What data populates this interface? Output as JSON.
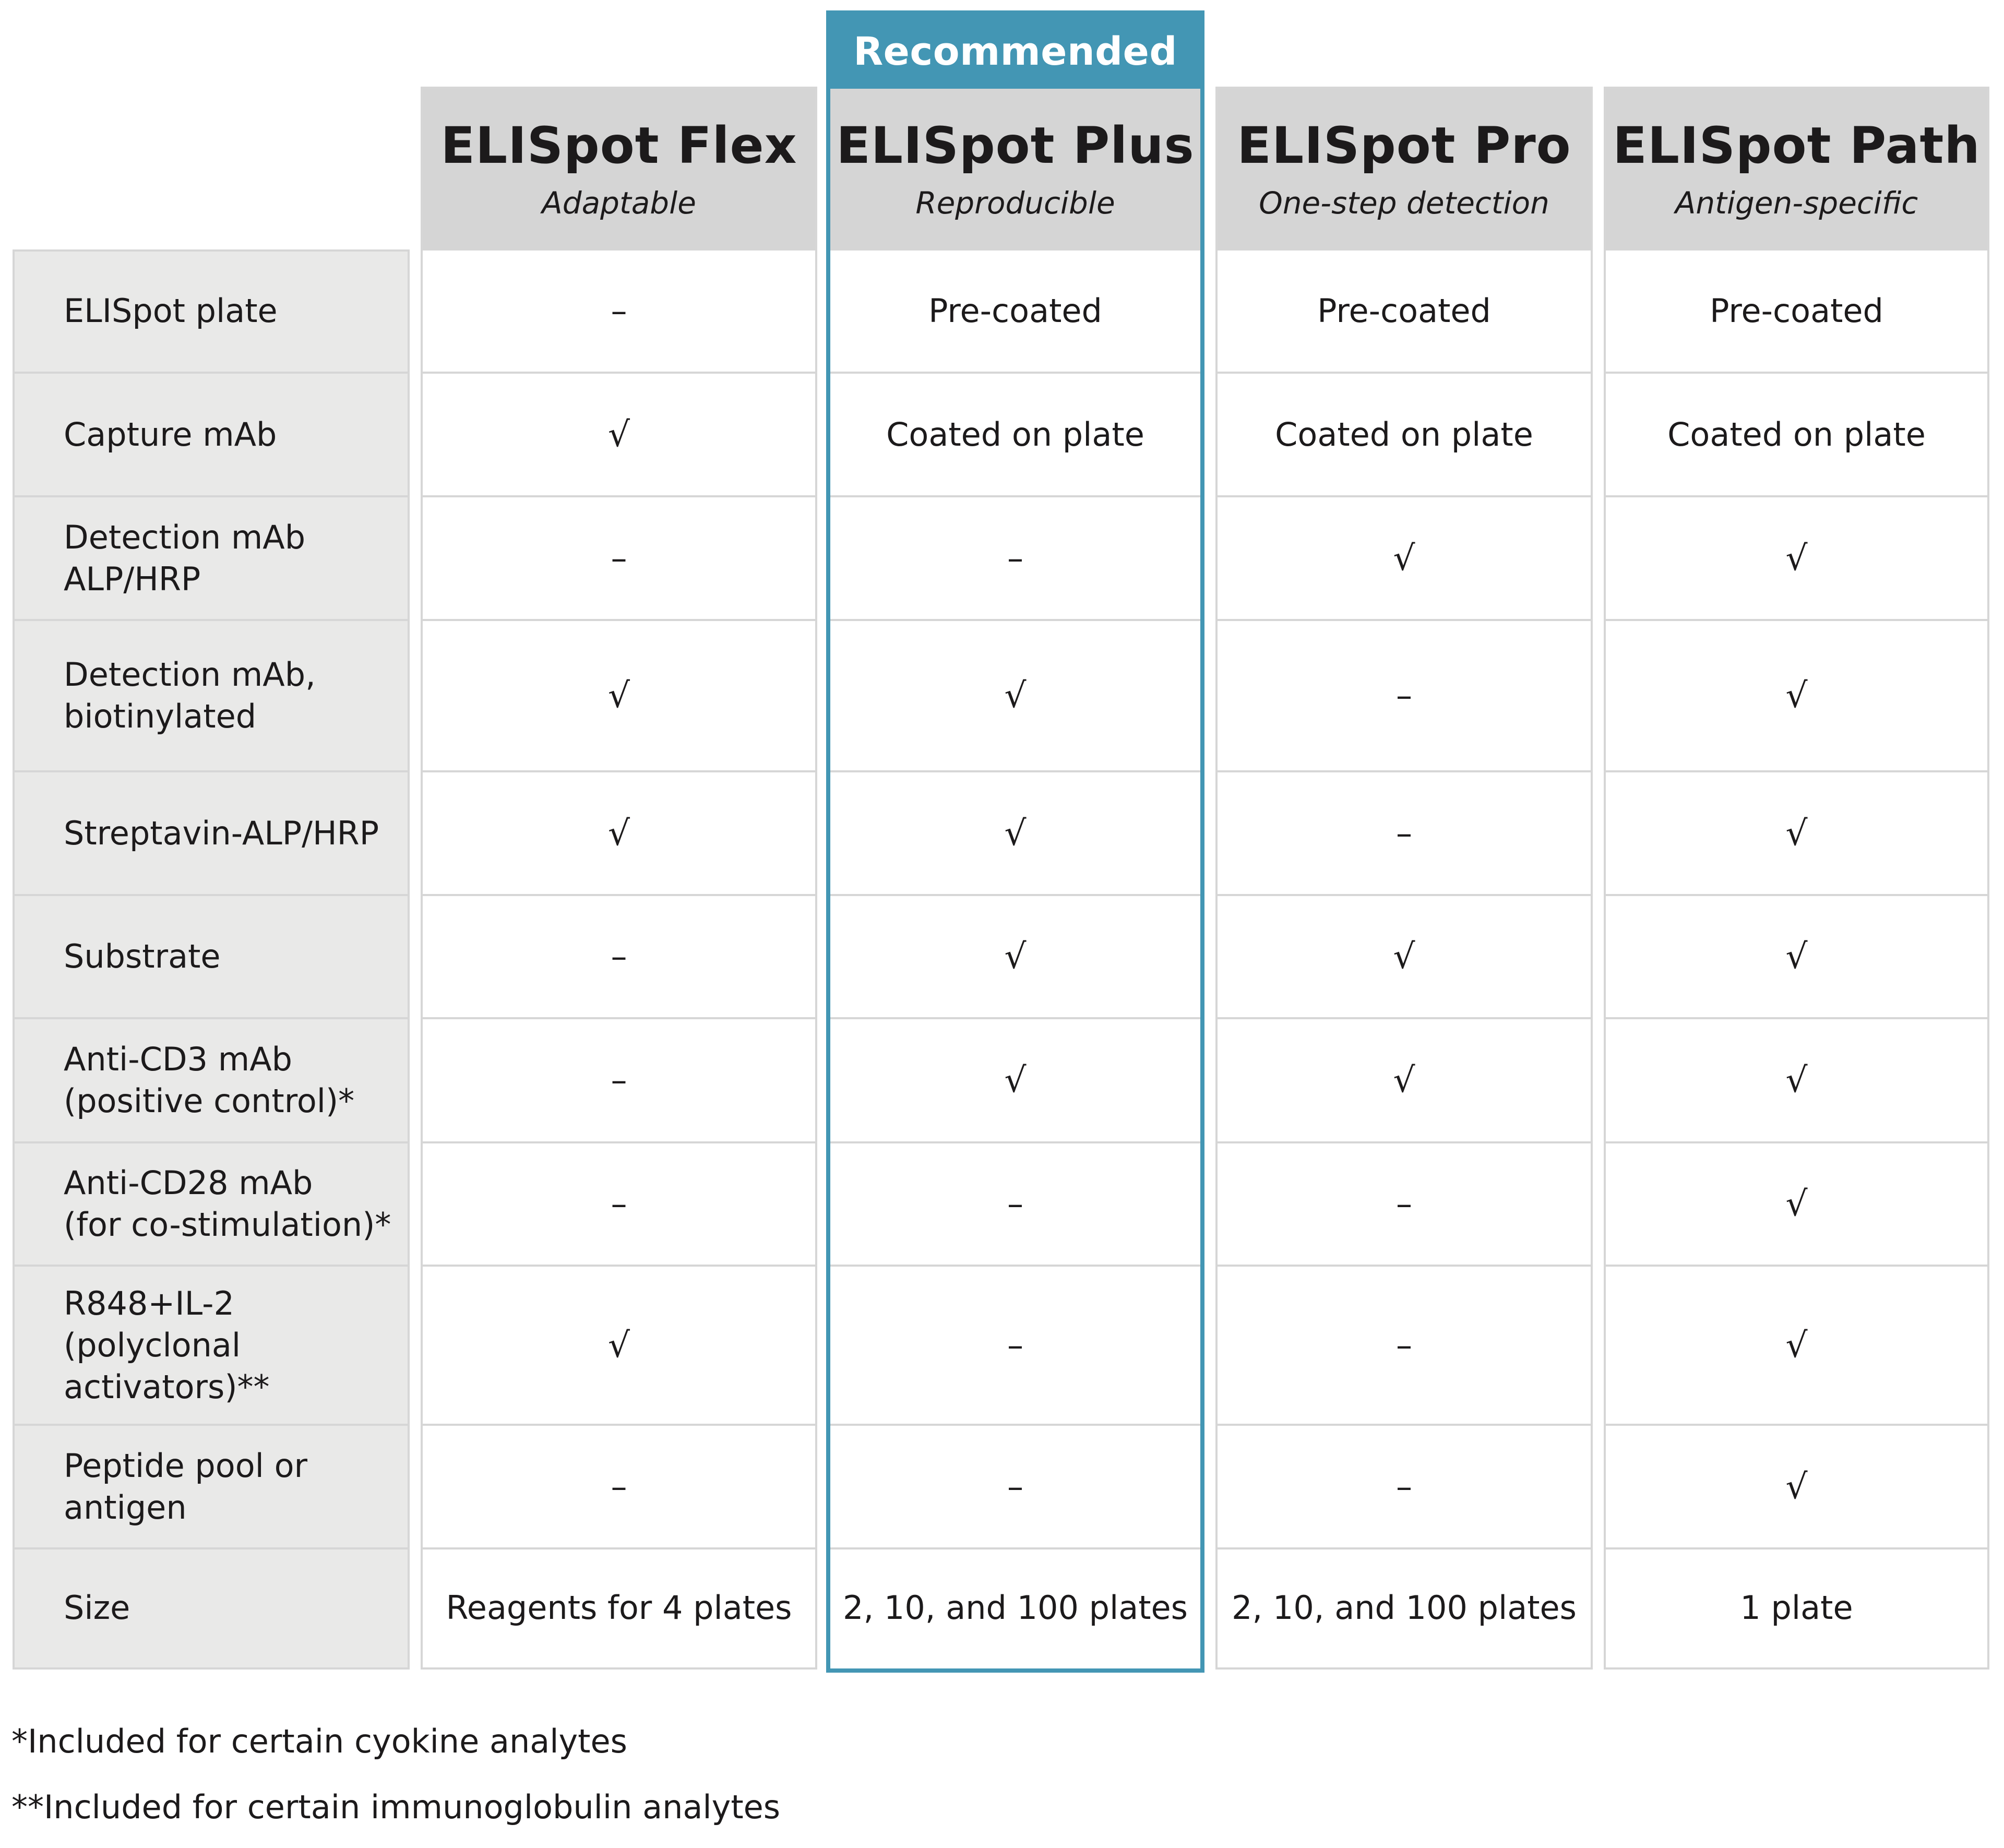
{
  "recommended_badge": "Recommended",
  "row_labels": [
    "ELISpot plate",
    "Capture mAb",
    "Detection mAb\nALP/HRP",
    "Detection mAb,\nbiotinylated",
    "Streptavin-ALP/HRP",
    "Substrate",
    "Anti-CD3 mAb\n(positive control)*",
    "Anti-CD28 mAb\n(for co-stimulation)*",
    "R848+IL-2\n(polyclonal\nactivators)**",
    "Peptide pool or\nantigen",
    "Size"
  ],
  "symbols": {
    "check": "√",
    "dash": "–"
  },
  "products": [
    {
      "name": "ELISpot Flex",
      "tagline": "Adaptable",
      "recommended": false,
      "values": [
        "–",
        "√",
        "–",
        "√",
        "√",
        "–",
        "–",
        "–",
        "√",
        "–",
        "Reagents for 4 plates"
      ]
    },
    {
      "name": "ELISpot Plus",
      "tagline": "Reproducible",
      "recommended": true,
      "values": [
        "Pre-coated",
        "Coated on plate",
        "–",
        "√",
        "√",
        "√",
        "√",
        "–",
        "–",
        "–",
        "2, 10, and 100 plates"
      ]
    },
    {
      "name": "ELISpot Pro",
      "tagline": "One-step detection",
      "recommended": false,
      "values": [
        "Pre-coated",
        "Coated on plate",
        "√",
        "–",
        "–",
        "√",
        "√",
        "–",
        "–",
        "–",
        "2, 10, and 100 plates"
      ]
    },
    {
      "name": "ELISpot Path",
      "tagline": "Antigen-specific",
      "recommended": false,
      "values": [
        "Pre-coated",
        "Coated on plate",
        "√",
        "√",
        "√",
        "√",
        "√",
        "√",
        "√",
        "√",
        "1 plate"
      ]
    }
  ],
  "footnotes": [
    "*Included for certain cyokine analytes",
    "**Included for certain immunoglobulin analytes"
  ],
  "colors": {
    "accent": "#4396b4",
    "header_bg": "#d5d5d5",
    "label_bg": "#e9e9e8",
    "grid": "#d6d6d6"
  }
}
